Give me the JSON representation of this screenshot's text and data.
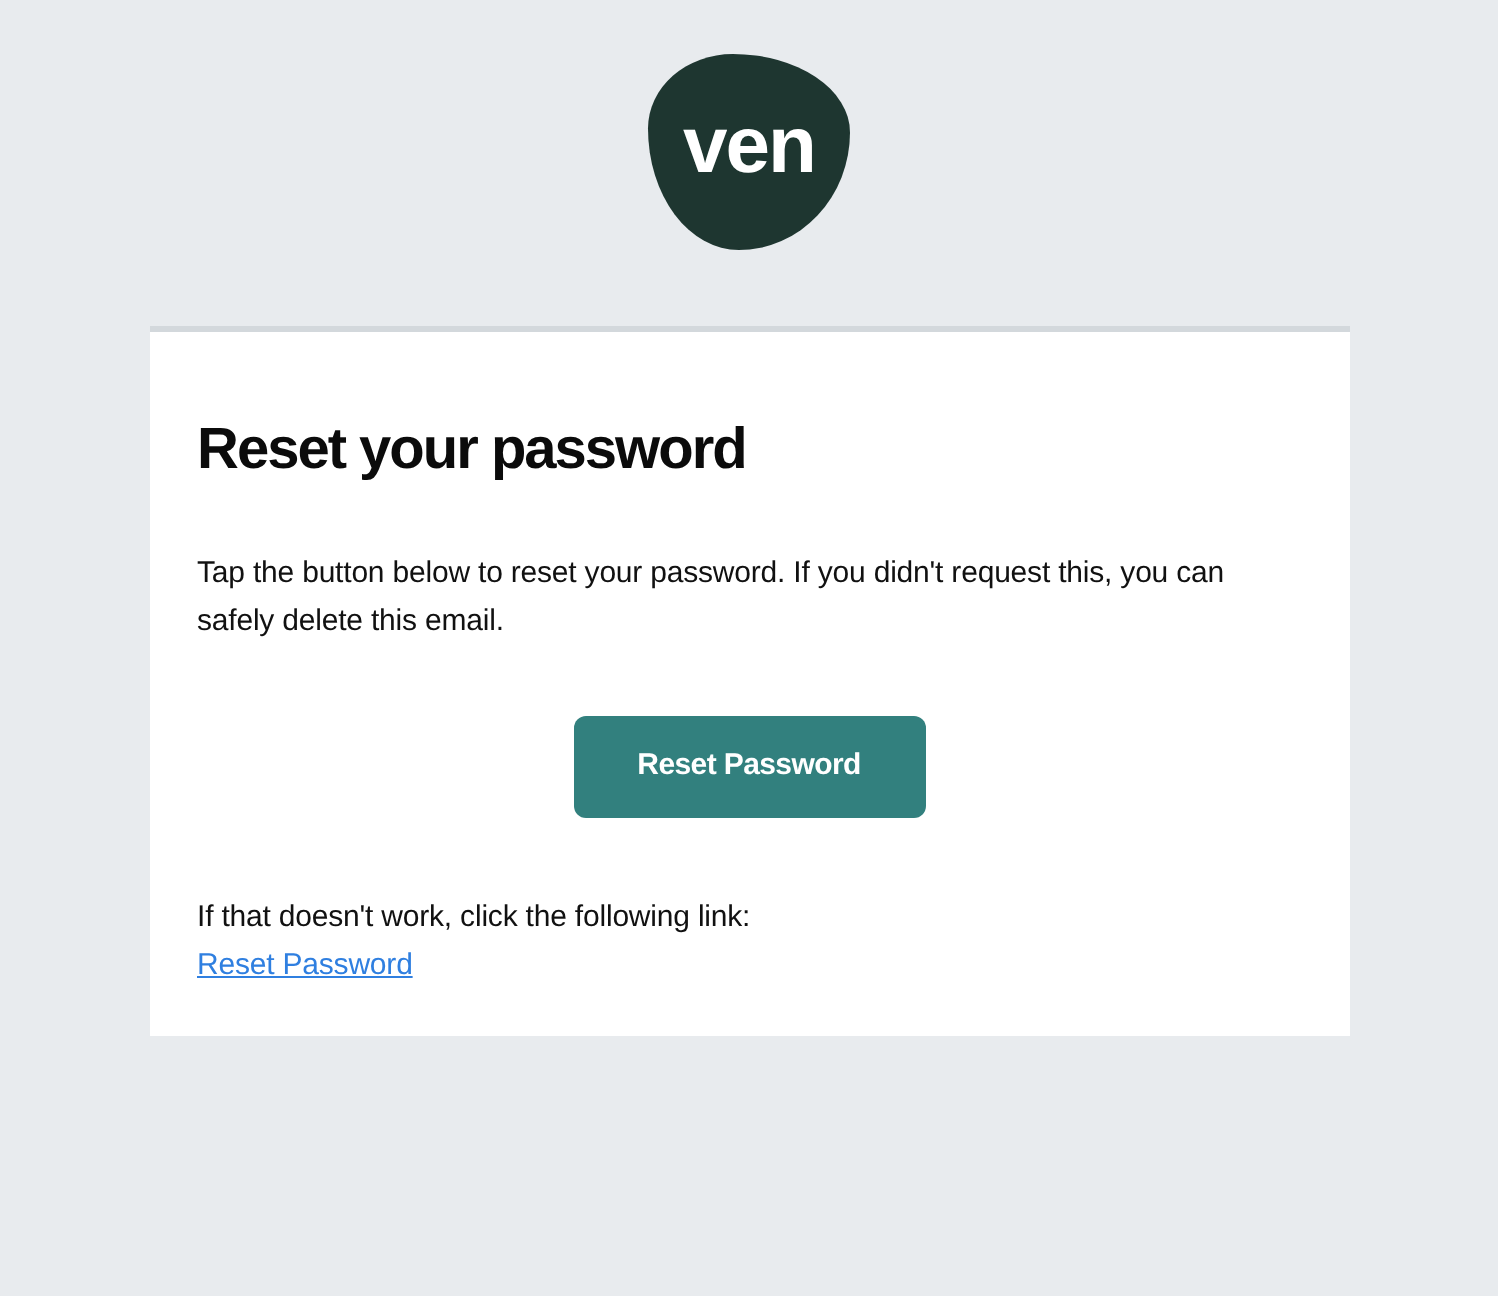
{
  "logo": {
    "text": "ven"
  },
  "card": {
    "title": "Reset your password",
    "intro": "Tap the button below to reset your password. If you didn't request this, you can safely delete this email.",
    "button": "Reset Password",
    "fallback_text": "If that doesn't work, click the following link:",
    "fallback_link": "Reset Password"
  }
}
